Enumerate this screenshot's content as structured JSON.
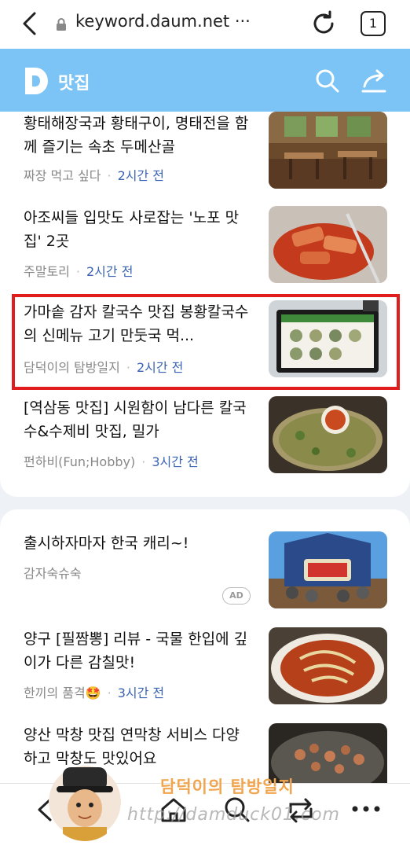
{
  "browser": {
    "url": "keyword.daum.net ···",
    "tab_count": "1"
  },
  "header": {
    "title": "맛집"
  },
  "feed": [
    {
      "title": "황태해장국과 황태구이, 명태전을 함께 즐기는 속초 두메산골",
      "source": "짜장 먹고 싶다",
      "time": "2시간 전"
    },
    {
      "title": "아조씨들 입맛도 사로잡는 '노포 맛집' 2곳",
      "source": "주말토리",
      "time": "2시간 전"
    },
    {
      "title": "가마솥 감자 칼국수 맛집 봉황칼국수의 신메뉴 고기 만둣국 먹...",
      "source": "담덕이의 탐방일지",
      "time": "2시간 전"
    },
    {
      "title": "[역삼동 맛집] 시원함이 남다른 칼국수&수제비 맛집, 밀가",
      "source": "펀하비(Fun;Hobby)",
      "time": "3시간 전"
    }
  ],
  "feed2": [
    {
      "title": "출시하자마자 한국 캐리~!",
      "source": "감자숙슈숙",
      "badge": "AD"
    },
    {
      "title": "양구 [필짬뽕] 리뷰 - 국물 한입에 깊이가 다른 감칠맛!",
      "source": "한끼의 품격🤩",
      "time": "3시간 전"
    },
    {
      "title": "양산 막창 맛집 연막창 서비스 다양하고 막창도 맛있어요",
      "source": "",
      "time": ""
    }
  ],
  "watermark": {
    "name": "담덕이의 탐방일지",
    "url": "http://damduck01.com"
  },
  "colors": {
    "header_bg": "#7cc4f5",
    "time_text": "#3a63b3",
    "highlight_border": "#e01c1c"
  }
}
